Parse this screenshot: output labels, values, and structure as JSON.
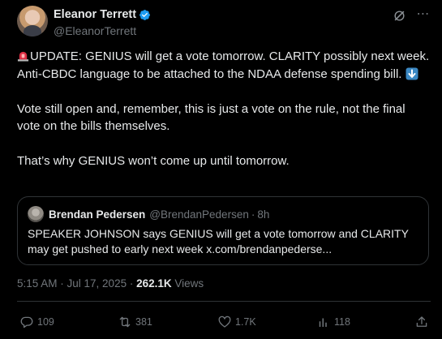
{
  "author": {
    "display_name": "Eleanor Terrett",
    "handle": "@EleanorTerrett"
  },
  "tweet": {
    "paragraph1": "UPDATE: GENIUS will get a vote tomorrow. CLARITY possibly next week. Anti-CBDC language to be attached to the NDAA defense spending bill.",
    "paragraph2": "Vote still open and, remember, this is just a vote on the rule, not the final vote on the bills themselves.",
    "paragraph3": "That’s why GENIUS won’t come up until tomorrow."
  },
  "quote": {
    "display_name": "Brendan Pedersen",
    "handle": "@BrendanPedersen",
    "separator": "·",
    "time": "8h",
    "text": "SPEAKER JOHNSON says GENIUS will get a vote tomorrow and CLARITY may get pushed to early next week x.com/brendanpederse..."
  },
  "meta": {
    "timestamp": "5:15 AM · Jul 17, 2025 · ",
    "views_count": "262.1K",
    "views_label": " Views"
  },
  "actions": {
    "replies": "109",
    "reposts": "381",
    "likes": "1.7K",
    "bookmarks": "118"
  },
  "icons": {
    "verified": "verified-badge-icon",
    "grok": "grok-icon",
    "more": "more-icon",
    "siren": "police-light-emoji",
    "down_arrow": "down-arrow-emoji",
    "reply": "reply-icon",
    "repost": "repost-icon",
    "like": "heart-icon",
    "bookmark": "bookmark-icon",
    "share": "share-icon"
  },
  "colors": {
    "background": "#000000",
    "text_primary": "#e7e9ea",
    "text_secondary": "#71767b",
    "border": "#2f3336",
    "verified_blue": "#1d9bf0"
  }
}
